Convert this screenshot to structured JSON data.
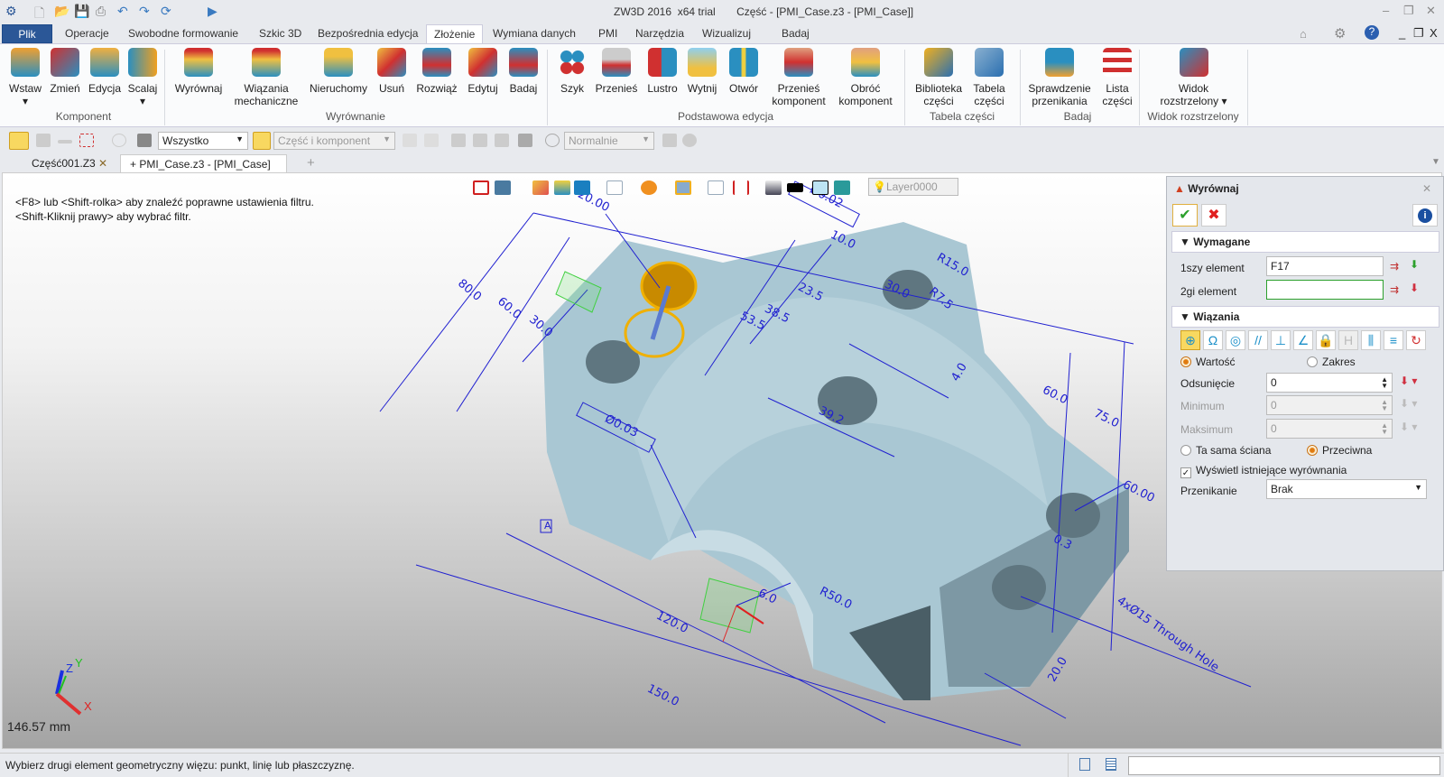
{
  "titlebar": {
    "app": "ZW3D 2016  x64 trial",
    "doc": "Część - [PMI_Case.z3 - [PMI_Case]]",
    "min": "–",
    "restore": "❐",
    "close": "✕"
  },
  "menu": {
    "file": "Plik",
    "tabs": [
      "Operacje",
      "Swobodne formowanie",
      "Szkic 3D",
      "Bezpośrednia edycja",
      "Złożenie",
      "Wymiana danych",
      "PMI",
      "Narzędzia",
      "Wizualizuj",
      "Badaj"
    ],
    "active": "Złożenie"
  },
  "ribbon": {
    "buttons": [
      {
        "label": "Wstaw",
        "sub": "▾"
      },
      {
        "label": "Zmień"
      },
      {
        "label": "Edycja"
      },
      {
        "label": "Scalaj",
        "sub": "▾"
      },
      {
        "label": "Wyrównaj"
      },
      {
        "label": "Wiązania",
        "sub": "mechaniczne"
      },
      {
        "label": "Nieruchomy"
      },
      {
        "label": "Usuń"
      },
      {
        "label": "Rozwiąż"
      },
      {
        "label": "Edytuj"
      },
      {
        "label": "Badaj"
      },
      {
        "label": "Szyk"
      },
      {
        "label": "Przenieś"
      },
      {
        "label": "Lustro"
      },
      {
        "label": "Wytnij"
      },
      {
        "label": "Otwór"
      },
      {
        "label": "Przenieś",
        "sub": "komponent"
      },
      {
        "label": "Obróć",
        "sub": "komponent"
      },
      {
        "label": "Biblioteka",
        "sub": "części"
      },
      {
        "label": "Tabela",
        "sub": "części"
      },
      {
        "label": "Sprawdzenie",
        "sub": "przenikania"
      },
      {
        "label": "Lista",
        "sub": "części"
      },
      {
        "label": "Widok",
        "sub": "rozstrzelony ▾"
      }
    ],
    "groups": [
      "Komponent",
      "Wyrównanie",
      "Podstawowa edycja",
      "Tabela części",
      "Badaj",
      "Widok rozstrzelony"
    ]
  },
  "toolbar": {
    "filter": "Wszystko",
    "pick": "Część i komponent",
    "mode": "Normalnie"
  },
  "doctabs": [
    {
      "label": "Część001.Z3",
      "close": "✕"
    },
    {
      "label": "+ PMI_Case.z3 - [PMI_Case]",
      "close": "✕"
    }
  ],
  "doctab_add": "+",
  "viewport": {
    "hints": [
      "<F8> lub <Shift-rolka> aby znaleźć poprawne ustawienia filtru.",
      "<Shift-Kliknij prawy> aby wybrać filtr."
    ],
    "layer": "Layer0000",
    "scale": "146.57 mm",
    "axes": {
      "x": "X",
      "y": "Y",
      "z": "Z"
    },
    "dims": [
      "80.0",
      "60.0",
      "30.0",
      "20.00",
      "Ø0.02",
      "10.0",
      "R15.0",
      "30.0",
      "R7.5",
      "23.5",
      "38.5",
      "53.5",
      "4.0",
      "39.2",
      "60.0",
      "75.0",
      "Ø0.03",
      "A",
      "R50.0",
      "6.0",
      "120.0",
      "150.0",
      "60.00",
      "0.3",
      "4xØ15 Through Hole",
      "20.0"
    ],
    "part_color": "#a9c7d3",
    "dim_color": "#2020d0"
  },
  "panel": {
    "title": "Wyrównaj",
    "close": "✕",
    "ok": "✔",
    "cancel": "✖",
    "info": "i",
    "required": {
      "title": "Wymagane",
      "first_label": "1szy element",
      "first_value": "F17",
      "second_label": "2gi element",
      "second_value": ""
    },
    "constraints": {
      "title": "Wiązania",
      "icons": [
        "coincident",
        "tangent",
        "concentric",
        "parallel",
        "perpendicular",
        "angle",
        "lock",
        "distance",
        "symmetric",
        "centered",
        "cam"
      ],
      "value": "Wartość",
      "range": "Zakres",
      "offset_label": "Odsunięcie",
      "offset": "0",
      "min_label": "Minimum",
      "min": "0",
      "max_label": "Maksimum",
      "max": "0",
      "same": "Ta sama ściana",
      "opposite": "Przeciwna",
      "show_existing": "Wyświetl istniejące wyrównania",
      "show_existing_checked": true,
      "interf_label": "Przenikanie",
      "interf": "Brak"
    }
  },
  "status": {
    "text": "Wybierz drugi element geometryczny więzu: punkt, linię lub płaszczyznę."
  }
}
